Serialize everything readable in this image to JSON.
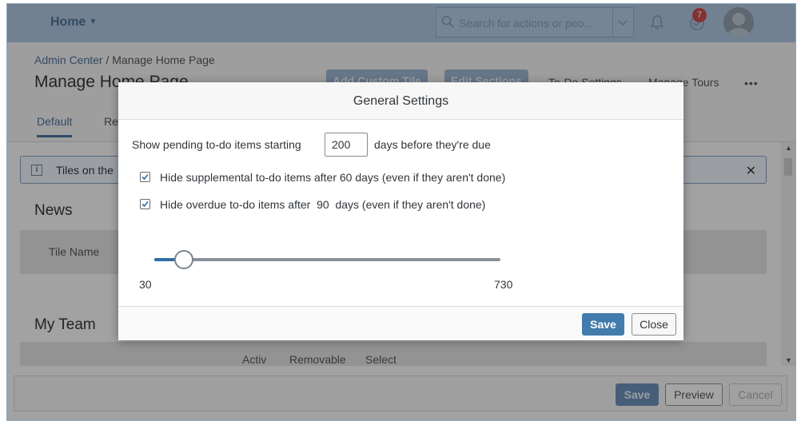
{
  "shell": {
    "home_label": "Home",
    "search_placeholder": "Search for actions or peo...",
    "todo_badge": "7"
  },
  "page": {
    "breadcrumb_root": "Admin Center",
    "breadcrumb_sep": " / ",
    "breadcrumb_current": "Manage Home Page",
    "title": "Manage Home Page",
    "header_buttons": [
      "Add Custom Tile",
      "Edit Sections"
    ],
    "header_links": [
      "To-Do Settings",
      "Manage Tours"
    ],
    "more": "•••",
    "tabs": [
      "Default",
      "Re"
    ]
  },
  "content": {
    "info_text": "Tiles on the",
    "sections": [
      "News",
      "My Team"
    ],
    "news_table_header": "Tile Name",
    "team_table_headers": [
      "Activ",
      "Removable",
      "Select"
    ],
    "footer_buttons": [
      "Save",
      "Preview",
      "Cancel"
    ]
  },
  "dialog": {
    "title": "General Settings",
    "pending_prefix": "Show pending to-do items starting",
    "pending_days": "200",
    "pending_suffix": "days before they're due",
    "checkbox1_label": "Hide supplemental to-do items after 60 days (even if they aren't done)",
    "checkbox1_checked": true,
    "checkbox2_label": "Hide overdue to-do items after  90  days (even if they aren't done)",
    "checkbox2_checked": true,
    "slider": {
      "min": "30",
      "max": "730",
      "value": 90
    },
    "save_label": "Save",
    "close_label": "Close"
  },
  "colors": {
    "primary": "#427cac",
    "shell": "#a9c0d9",
    "slider_fill": "#2f6da6"
  }
}
